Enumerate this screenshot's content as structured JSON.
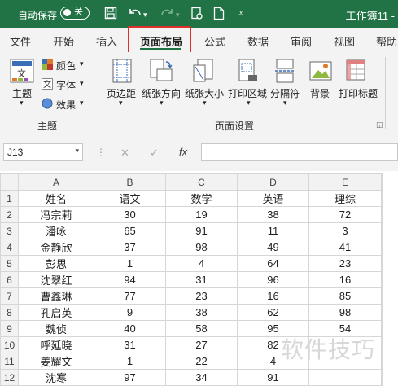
{
  "titlebar": {
    "autosave_label": "自动保存",
    "toggle_state": "关",
    "workbook_title": "工作簿11 -",
    "icons": [
      "save-icon",
      "undo-icon",
      "redo-icon",
      "touch-mode-icon",
      "new-file-icon",
      "customize-qat-icon"
    ],
    "background": "#217346"
  },
  "tabs": [
    "文件",
    "开始",
    "插入",
    "页面布局",
    "公式",
    "数据",
    "审阅",
    "视图",
    "帮助"
  ],
  "active_tab": "页面布局",
  "ribbon": {
    "theme": {
      "themes_label": "主题",
      "colors_label": "颜色",
      "fonts_label": "字体",
      "effects_label": "效果",
      "group_label": "主题"
    },
    "page_setup": {
      "margins_label": "页边距",
      "orientation_label": "纸张方向",
      "size_label": "纸张大小",
      "print_area_label": "打印区域",
      "breaks_label": "分隔符",
      "background_label": "背景",
      "print_titles_label": "打印标题",
      "group_label": "页面设置"
    }
  },
  "formula_bar": {
    "name_box": "J13",
    "fx_label": "fx",
    "cancel_symbol": "✕",
    "enter_symbol": "✓",
    "formula": ""
  },
  "sheet": {
    "columns": [
      "A",
      "B",
      "C",
      "D",
      "E"
    ],
    "rows": [
      [
        "姓名",
        "语文",
        "数学",
        "英语",
        "理综"
      ],
      [
        "冯宗莉",
        "30",
        "19",
        "38",
        "72"
      ],
      [
        "潘咏",
        "65",
        "91",
        "11",
        "3"
      ],
      [
        "金静欣",
        "37",
        "98",
        "49",
        "41"
      ],
      [
        "彭思",
        "1",
        "4",
        "64",
        "23"
      ],
      [
        "沈翠红",
        "94",
        "31",
        "96",
        "16"
      ],
      [
        "曹鑫琳",
        "77",
        "23",
        "16",
        "85"
      ],
      [
        "孔启英",
        "9",
        "38",
        "62",
        "98"
      ],
      [
        "魏侦",
        "40",
        "58",
        "95",
        "54"
      ],
      [
        "呼延晓",
        "31",
        "27",
        "82",
        ""
      ],
      [
        "姜耀文",
        "1",
        "22",
        "4",
        ""
      ],
      [
        "沈寒",
        "97",
        "34",
        "91",
        ""
      ]
    ]
  },
  "watermark": "软件技巧"
}
